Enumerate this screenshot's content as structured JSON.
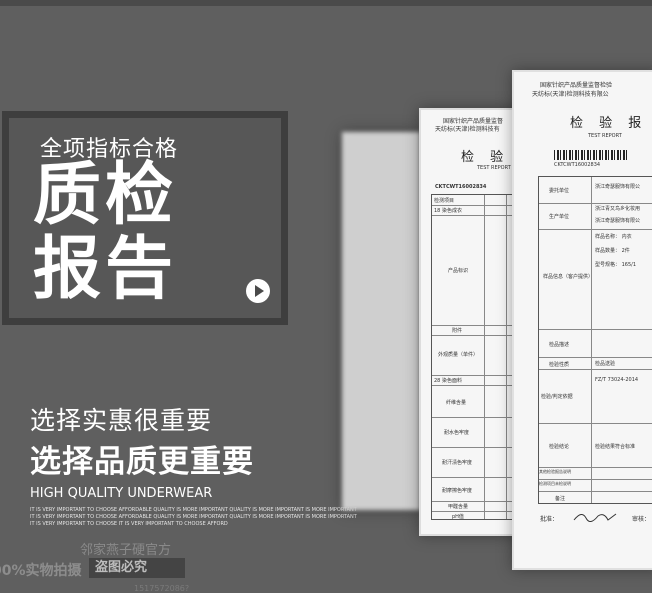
{
  "hero": {
    "subtitle": "全项指标合格",
    "title_line1": "质检",
    "title_line2": "报告"
  },
  "slogan": {
    "line1": "选择实惠很重要",
    "line2": "选择品质更重要",
    "english": "HIGH QUALITY UNDERWEAR",
    "fine_lines": [
      "IT IS VERY IMPORTANT TO CHOOSE AFFORDABLE QUALITY IS MORE IMPORTANT QUALITY IS MORE IMPORTANT IS MORE IMPORTANT",
      "IT IS VERY IMPORTANT TO CHOOSE AFFORDABLE QUALITY IS MORE IMPORTANT QUALITY IS MORE IMPORTANT IS MORE IMPORTANT",
      "IT IS VERY IMPORTANT TO CHOOSE IT IS VERY IMPORTANT TO CHOOSE AFFORD"
    ]
  },
  "watermark": {
    "shop": "邻家燕子硬官方",
    "real_photo": "00%实物拍摄",
    "no_steal": "盗图必究",
    "number": "1517572086?"
  },
  "document_mid": {
    "org1": "国家针织产品质量监督",
    "org2": "天纺标(天津)检测科技有",
    "title": "检 验 报",
    "subtitle": "TEST REPORT",
    "report_no": "CKTCWT16002834",
    "rows": [
      "检测项目",
      "18  染色成衣",
      "产品标识",
      "附件",
      "外观质量（单件）",
      "28  染色面料",
      "纤维含量",
      "耐水色牢度",
      "耐汗渍色牢度",
      "耐摩擦色牢度",
      "甲醛含量",
      "pH值"
    ]
  },
  "document_front": {
    "org1": "国家针织产品质量监督检验",
    "org2": "天纺标(天津)检测科技有限公",
    "title": "检 验 报 告",
    "subtitle": "TEST REPORT",
    "report_no": "CKTCWT16002834",
    "rows": [
      "委托单位",
      "生产单位",
      "样品信息（客户提供）",
      "检品描述",
      "检验性质",
      "检验/判定依据",
      "检验结论",
      "其他检验报告说明",
      "检测项目未检说明",
      "备注"
    ],
    "values": [
      "浙江奇瑟服饰有限公",
      "浙江青又鸟乡化妆用",
      "浙江奇瑟服饰有限公",
      "样品名称： 内衣",
      "样品数量： 2件",
      "型号规格： 165/1",
      "检品送验",
      "FZ/T 73024-2014",
      "检验结果符合标准"
    ],
    "footer_left": "批准：",
    "footer_right": "审核："
  }
}
